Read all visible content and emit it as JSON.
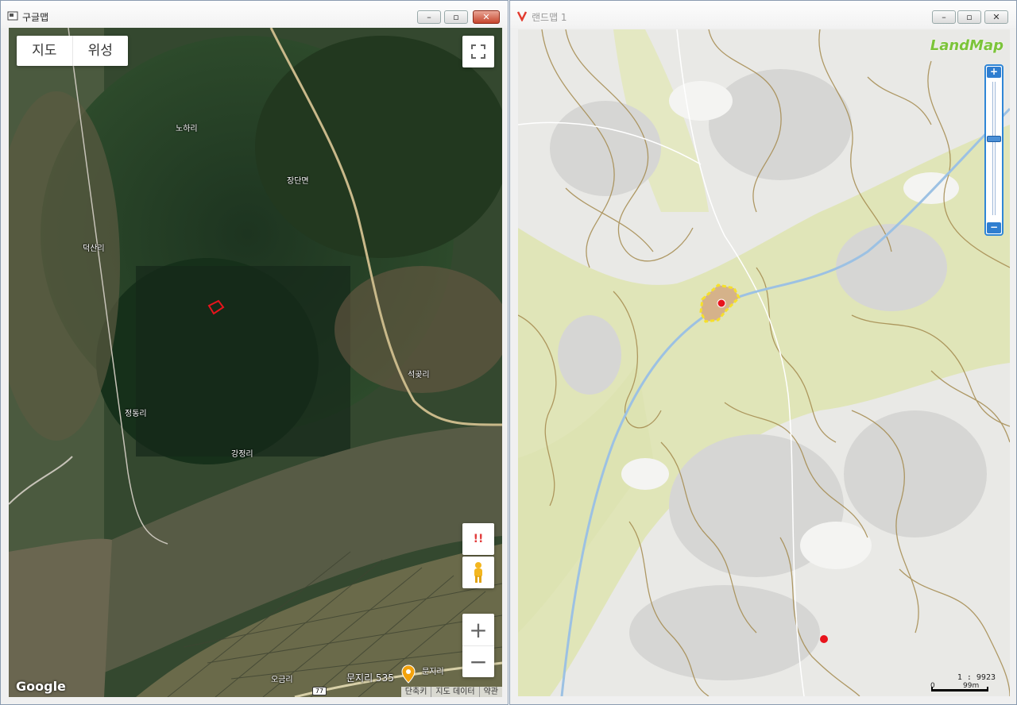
{
  "left_window": {
    "title": "구글맵",
    "controls": {
      "minimize": "–",
      "maximize": "▫",
      "close": "✕"
    },
    "map_type_toggle": {
      "map": "지도",
      "satellite": "위성"
    },
    "place_labels": [
      "노하리",
      "장단면",
      "덕산리",
      "석곶리",
      "정동리",
      "강정리",
      "오금리",
      "문지리"
    ],
    "poi_label": "문지리 535",
    "road_shield": "77",
    "alert_label": "!!",
    "zoom_in": "+",
    "zoom_out": "−",
    "logo": "Google",
    "footer": {
      "shortcuts": "단축키",
      "map_data": "지도 데이터",
      "terms": "약관"
    }
  },
  "right_window": {
    "title": "랜드맵 1",
    "controls": {
      "minimize": "–",
      "maximize": "▫",
      "close": "✕"
    },
    "logo": "LandMap",
    "zoom_in": "+",
    "zoom_out": "−",
    "scale_text": "1 : 9923",
    "scale_bar_labels": [
      "0",
      "99m"
    ]
  },
  "icons": [
    "window-app-icon",
    "landmap-app-icon",
    "fullscreen-icon",
    "pegman-icon",
    "pin-icon",
    "location-marker-icon"
  ],
  "colors": {
    "parcel_outline": "#e8141c",
    "parcel_highlight": "#f6e02a",
    "river": "#9cc1e3",
    "contour": "#a48a4e",
    "landmap_green": "#7cc43a",
    "zoom_blue": "#2f7ed0"
  }
}
